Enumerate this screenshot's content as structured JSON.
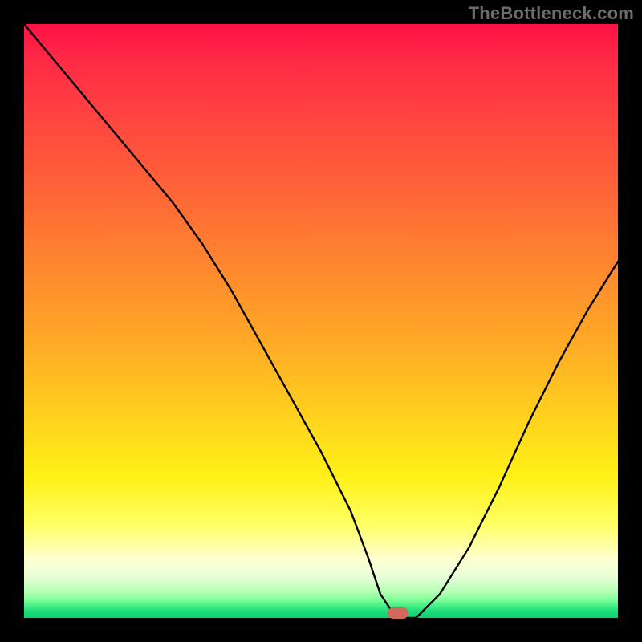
{
  "watermark": "TheBottleneck.com",
  "colors": {
    "frame_bg": "#000000",
    "watermark_text": "#6c6c6c",
    "curve_stroke": "#000000",
    "marker_fill": "#d1695c",
    "gradient_stops": [
      "#ff1246",
      "#ff2a46",
      "#ff4a3e",
      "#ff6a36",
      "#ff8a2e",
      "#ffab26",
      "#ffd11e",
      "#fff016",
      "#ffff60",
      "#ffffd0",
      "#e8ffd8",
      "#b7ffb6",
      "#7dff96",
      "#35e880",
      "#18db78",
      "#0fd072"
    ]
  },
  "marker": {
    "x_pct": 63,
    "y_pct": 99.2
  },
  "chart_data": {
    "type": "line",
    "title": "",
    "xlabel": "",
    "ylabel": "",
    "xlim": [
      0,
      100
    ],
    "ylim": [
      0,
      100
    ],
    "series": [
      {
        "name": "bottleneck-curve",
        "x": [
          0,
          5,
          10,
          15,
          20,
          25,
          30,
          35,
          40,
          45,
          50,
          55,
          58,
          60,
          62,
          64,
          66,
          70,
          75,
          80,
          85,
          90,
          95,
          100
        ],
        "y": [
          100,
          94,
          88,
          82,
          76,
          70,
          63,
          55,
          46,
          37,
          28,
          18,
          10,
          4,
          1,
          0,
          0,
          4,
          12,
          22,
          33,
          43,
          52,
          60
        ]
      }
    ],
    "notes": "y represents bottleneck severity (100 = worst/red top, 0 = best/green bottom). Curve reaches a flat minimum around x≈62–66 then rises again. Marker sits at the minimum near x≈63."
  }
}
